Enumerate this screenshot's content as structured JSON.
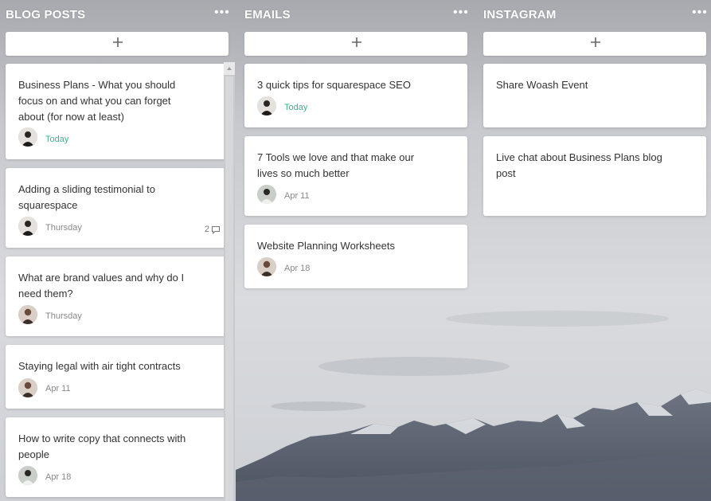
{
  "columns": [
    {
      "title": "BLOG POSTS",
      "cards": [
        {
          "title": "Business Plans - What you should focus on and what you can forget about (for now at least)",
          "date": "Today"
        },
        {
          "title": "Adding a sliding testimonial to squarespace",
          "date": "Thursday",
          "comments": "2"
        },
        {
          "title": "What are brand values and why do I need them?",
          "date": "Thursday"
        },
        {
          "title": "Staying legal with air tight contracts",
          "date": "Apr 11"
        },
        {
          "title": "How to write copy that connects with people",
          "date": "Apr 18"
        }
      ]
    },
    {
      "title": "EMAILS",
      "cards": [
        {
          "title": "3 quick tips for squarespace SEO",
          "date": "Today"
        },
        {
          "title": "7 Tools we love and that make our lives so much better",
          "date": "Apr 11"
        },
        {
          "title": "Website Planning Worksheets",
          "date": "Apr 18"
        }
      ]
    },
    {
      "title": "INSTAGRAM",
      "cards": [
        {
          "title": "Share Woash Event"
        },
        {
          "title": "Live chat about Business Plans blog post"
        }
      ]
    }
  ],
  "icons": {
    "more": "more-horizontal-icon",
    "add": "plus-icon",
    "comment": "comment-icon",
    "scroll": "scroll-up-arrow-icon"
  },
  "colors": {
    "today": "#3fb08a",
    "header_text": "#ffffff"
  }
}
